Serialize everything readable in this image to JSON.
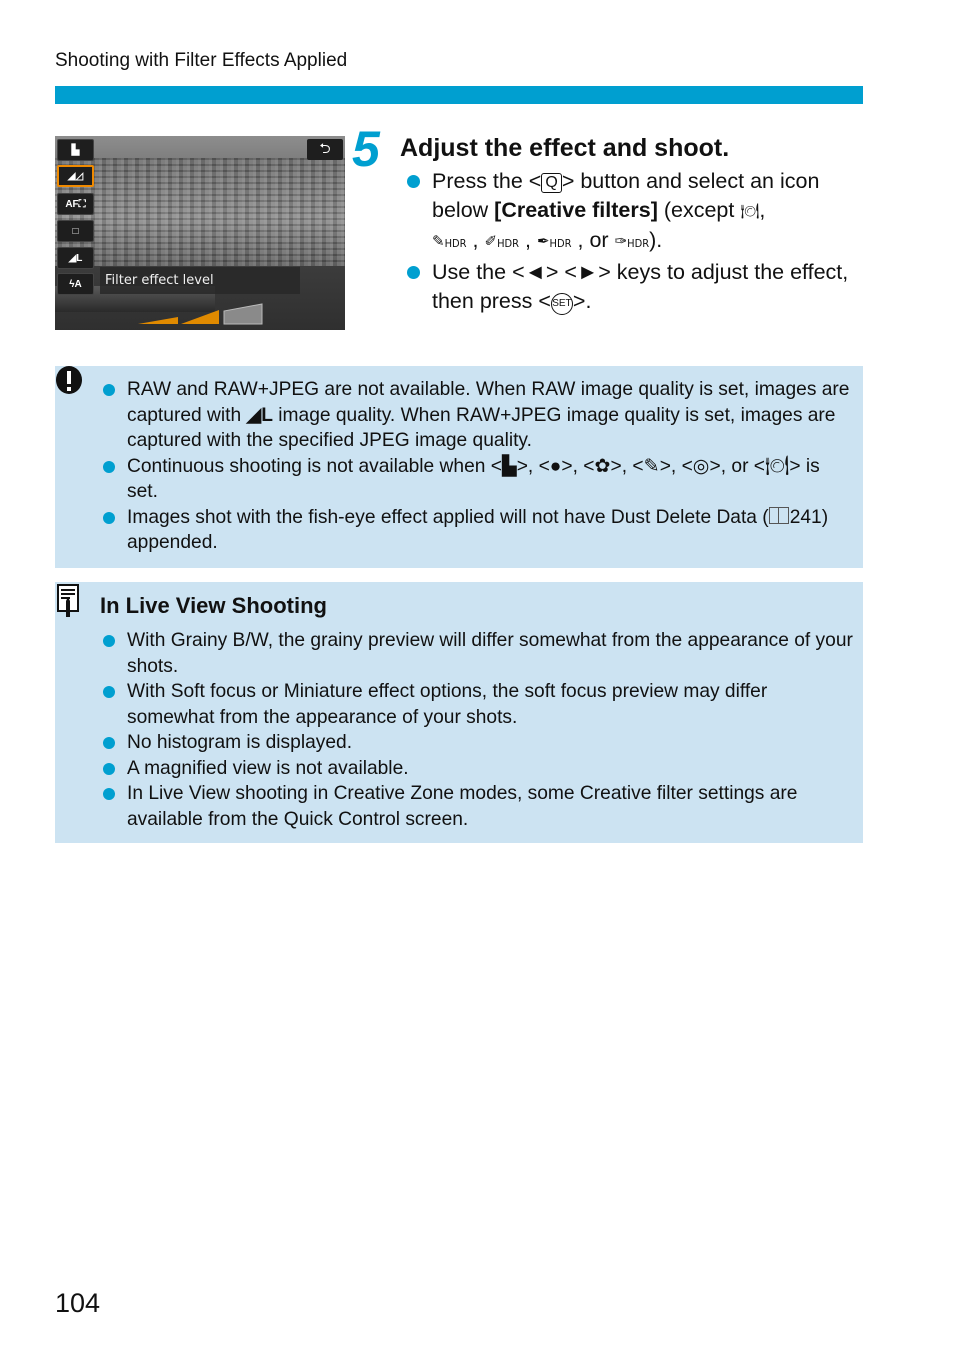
{
  "header": {
    "running_head": "Shooting with Filter Effects Applied",
    "accent_color": "#009fd0"
  },
  "camera_screen": {
    "side_buttons": [
      {
        "icon": "grainy-bw-icon",
        "glyph": "▙"
      },
      {
        "icon": "filter-effect-level-icon",
        "glyph": "◢◿",
        "selected": true
      },
      {
        "icon": "af-method-icon",
        "glyph": "AF⛶"
      },
      {
        "icon": "drive-mode-single-icon",
        "glyph": "□"
      },
      {
        "icon": "image-quality-large-fine-icon",
        "glyph": "◢L"
      },
      {
        "icon": "flash-auto-icon",
        "glyph": "ϟA"
      }
    ],
    "back_glyph": "⮌",
    "label": "Filter effect level",
    "level": {
      "selected": 2,
      "total": 3,
      "active_color": "#e08a00",
      "inactive_color": "#8a8a8a"
    }
  },
  "step": {
    "number": "5",
    "title": "Adjust the effect and shoot.",
    "bullet1": {
      "part1": "Press the <",
      "button": "Q",
      "part2": "> button and select an icon below ",
      "bold": "[Creative filters]",
      "part3": " (except ",
      "except_icons": [
        "food-icon",
        "art-standard-hdr-icon",
        "art-vivid-hdr-icon",
        "art-bold-hdr-icon",
        "art-embossed-hdr-icon"
      ],
      "hdr_label": "HDR",
      "sep_comma": ",",
      "or": "or",
      "close": ")."
    },
    "bullet2": {
      "part1": "Use the <◄> <►> keys to adjust the effect, then press <",
      "set": "SET",
      "part2": ">."
    }
  },
  "caution": {
    "items": [
      {
        "a": "RAW and RAW+JPEG are not available. When RAW image quality is set, images are captured with ",
        "icon": "◢L",
        "b": " image quality. When RAW+JPEG image quality is set, images are captured with the specified JPEG image quality."
      },
      {
        "a": "Continuous shooting is not available when <",
        "icons": [
          "▙",
          "●",
          "✿",
          "✎",
          "◎"
        ],
        "b": ">, or <",
        "c": "> is set."
      },
      {
        "a": "Images shot with the fish-eye effect applied will not have Dust Delete Data (",
        "page_ref": "241",
        "b": ") appended."
      }
    ]
  },
  "memo": {
    "title": "In Live View Shooting",
    "items": [
      "With Grainy B/W, the grainy preview will differ somewhat from the appearance of your shots.",
      "With Soft focus or Miniature effect options, the soft focus preview may differ somewhat from the appearance of your shots.",
      "No histogram is displayed.",
      "A magnified view is not available.",
      "In Live View shooting in Creative Zone modes, some Creative filter settings are available from the Quick Control screen."
    ]
  },
  "footer": {
    "page_number": "104"
  }
}
